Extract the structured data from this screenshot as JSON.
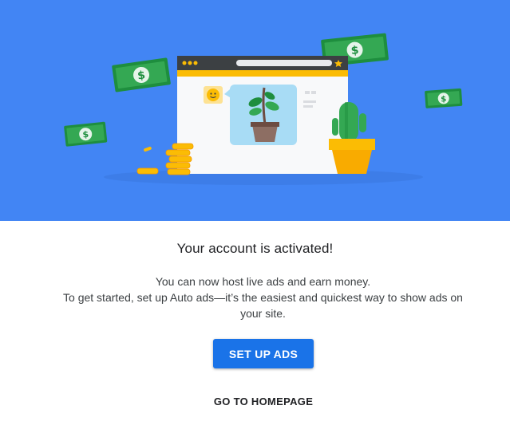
{
  "dialog": {
    "title": "Your account is activated!",
    "description_line1": "You can now host live ads and earn money.",
    "description_line2": "To get started, set up Auto ads—it’s the easiest and quickest way to show ads on your site.",
    "primary_button_label": "SET UP ADS",
    "secondary_button_label": "GO TO HOMEPAGE"
  },
  "illustration": {
    "money_symbol": "$",
    "hero_color": "#4285f4",
    "button_color": "#1a73e8",
    "icons": [
      "money-bill-icon",
      "browser-window-icon",
      "plant-pot-icon",
      "cactus-icon",
      "coin-stack-icon",
      "smiley-avatar-icon",
      "star-icon"
    ]
  }
}
